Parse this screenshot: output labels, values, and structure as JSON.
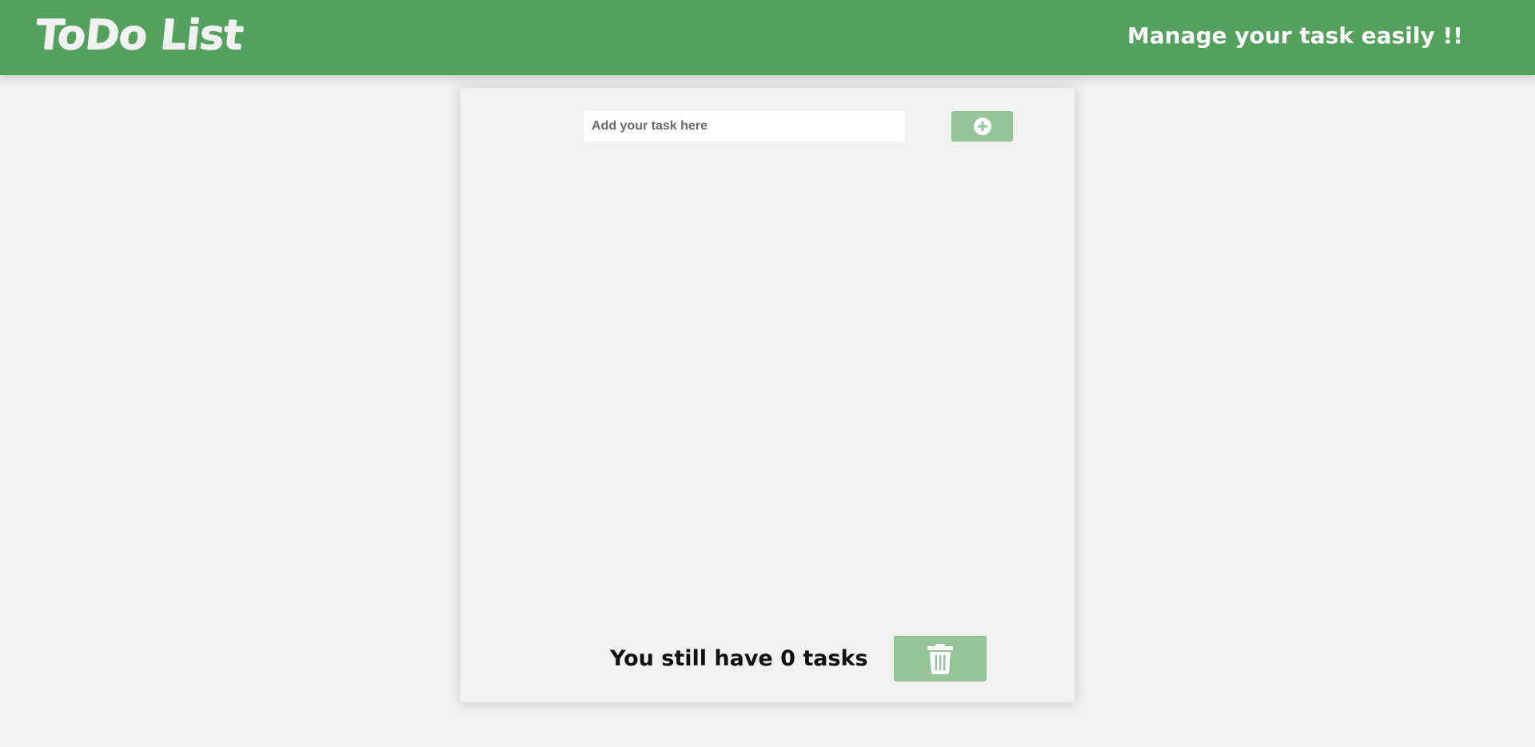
{
  "header": {
    "logo_text": "ToDo List",
    "tagline": "Manage your task easily !!"
  },
  "task_input": {
    "value": "",
    "placeholder": "Add your task here"
  },
  "add_button": {
    "icon": "plus-circle-icon"
  },
  "tasks": [],
  "footer": {
    "status_text": "You still have 0 tasks",
    "clear_icon": "trash-icon"
  },
  "colors": {
    "header_bg": "#53a15c",
    "button_bg": "#94c497",
    "page_bg": "#f1f1f1"
  }
}
